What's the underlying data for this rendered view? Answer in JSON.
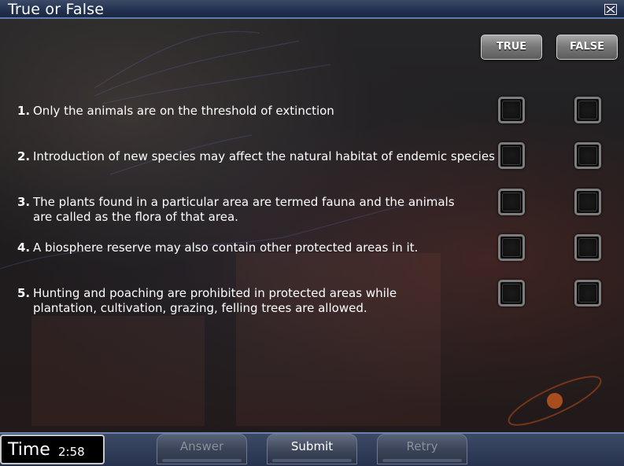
{
  "window": {
    "title": "True or False",
    "close_icon": "close-box-icon"
  },
  "columns": {
    "true_label": "TRUE",
    "false_label": "FALSE"
  },
  "questions": [
    {
      "number": "1.",
      "text": "Only the animals are on the threshold of extinction"
    },
    {
      "number": "2.",
      "text": "Introduction of new species may affect the natural habitat of endemic species"
    },
    {
      "number": "3.",
      "text": "The plants found in a particular area are termed fauna and the animals are called as the flora of that area."
    },
    {
      "number": "4.",
      "text": "A biosphere reserve may also contain other protected areas in it."
    },
    {
      "number": "5.",
      "text": "Hunting and poaching are prohibited in protected areas while plantation, cultivation, grazing, felling trees are allowed."
    }
  ],
  "footer": {
    "time_label": "Time",
    "time_value": "2:58",
    "answer_label": "Answer",
    "submit_label": "Submit",
    "retry_label": "Retry"
  },
  "colors": {
    "titlebar": "#223150",
    "footer": "#26324e",
    "button_gray": "#7a7a7a"
  }
}
